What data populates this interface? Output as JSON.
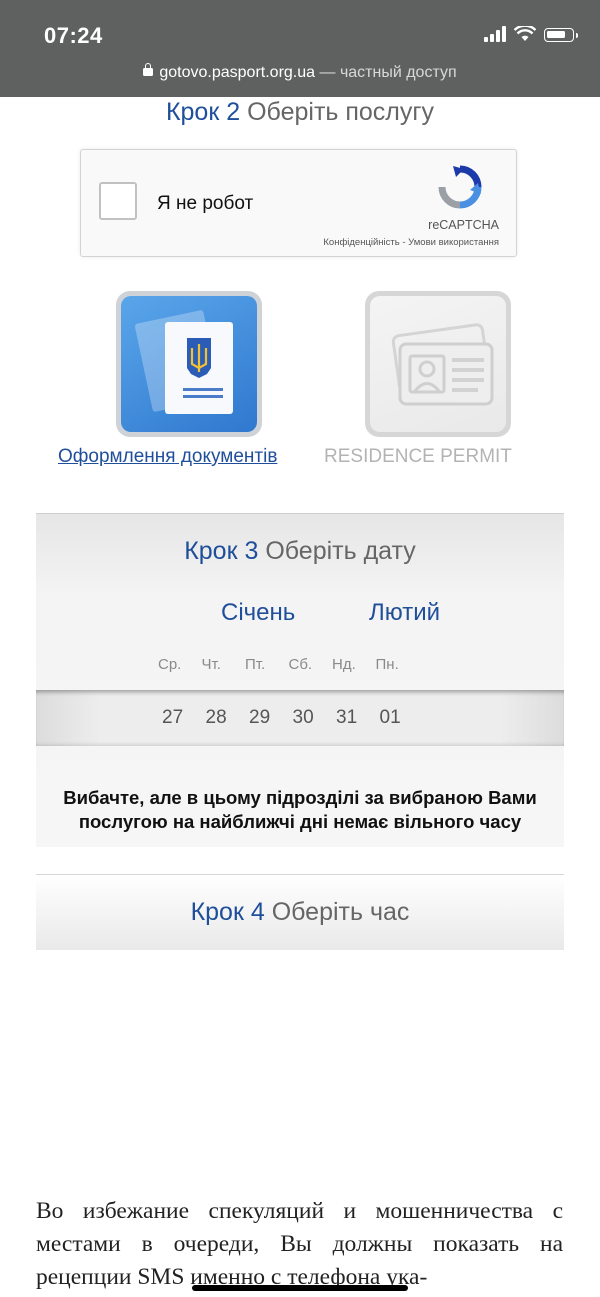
{
  "status_bar": {
    "time": "07:24",
    "url": "gotovo.pasport.org.ua",
    "url_separator": " — ",
    "access": "частный доступ"
  },
  "step2": {
    "num": "Крок 2",
    "title": "Оберіть послугу"
  },
  "captcha": {
    "label": "Я не робот",
    "brand": "reCAPTCHA",
    "privacy": "Конфіденційність",
    "sep": " - ",
    "terms": "Умови використання"
  },
  "services": [
    {
      "label": "Оформлення документів",
      "active": true
    },
    {
      "label": "RESIDENCE PERMIT",
      "active": false
    }
  ],
  "step3": {
    "num": "Крок 3",
    "title": "Оберіть дату",
    "months": [
      "Січень",
      "Лютий"
    ],
    "weekdays": [
      "Ср.",
      "Чт.",
      "Пт.",
      "Сб.",
      "Нд.",
      "Пн."
    ],
    "dates": [
      "27",
      "28",
      "29",
      "30",
      "31",
      "01"
    ],
    "message_line1": "Вибачте, але в цьому підрозділі за вибраною Вами",
    "message_line2": "послугою на найближчі дні немає вільного часу"
  },
  "step4": {
    "num": "Крок 4",
    "title": "Оберіть час"
  },
  "note": {
    "text": "Во избежание спекуляций и мошенничества с местами в очереди, Вы должны показать на рецепции SMS именно с телефона ука-"
  },
  "colors": {
    "accent": "#1f4f9a",
    "statusbar": "#5f6161"
  }
}
